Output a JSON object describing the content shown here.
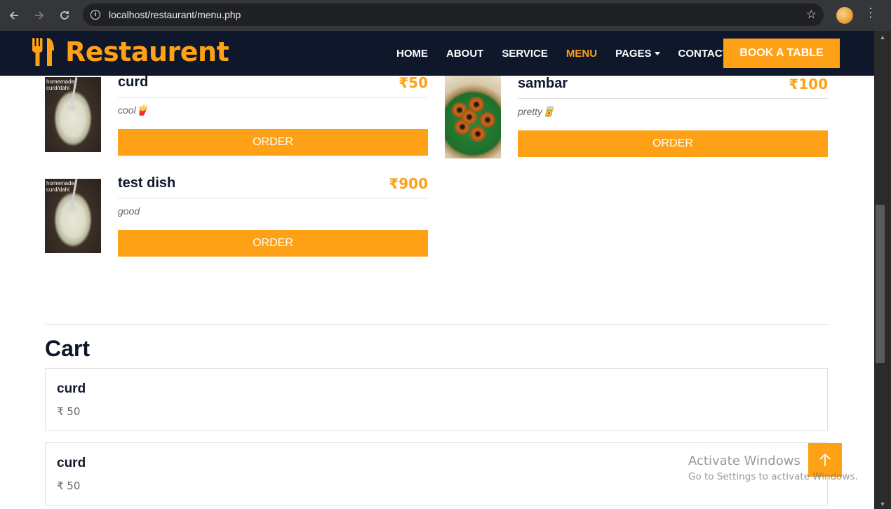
{
  "browser": {
    "url": "localhost/restaurant/menu.php",
    "back_icon": "arrow-left",
    "forward_icon": "arrow-right",
    "reload_icon": "reload",
    "info_icon": "info-circle",
    "bookmark_icon": "star-outline",
    "menu_icon": "vertical-dots"
  },
  "navbar": {
    "brand": "Restaurent",
    "links": [
      {
        "label": "HOME",
        "active": false
      },
      {
        "label": "ABOUT",
        "active": false
      },
      {
        "label": "SERVICE",
        "active": false
      },
      {
        "label": "MENU",
        "active": true
      },
      {
        "label": "PAGES",
        "active": false,
        "dropdown": true
      },
      {
        "label": "CONTACT",
        "active": false
      }
    ],
    "cta": "BOOK A TABLE"
  },
  "menu_items": [
    {
      "name": "curd",
      "price": "₹50",
      "desc": "cool🍟",
      "button": "ORDER",
      "image_label": "homemade\ncurd/dahi"
    },
    {
      "name": "sambar",
      "price": "₹100",
      "desc": "pretty🥫",
      "button": "ORDER"
    },
    {
      "name": "test dish",
      "price": "₹900",
      "desc": "good",
      "button": "ORDER",
      "image_label": "homemade\ncurd/dahi"
    }
  ],
  "cart": {
    "title": "Cart",
    "items": [
      {
        "name": "curd",
        "price": "₹ 50"
      },
      {
        "name": "curd",
        "price": "₹ 50"
      }
    ]
  },
  "back_to_top_icon": "arrow-up",
  "watermark": {
    "title": "Activate Windows",
    "subtitle": "Go to Settings to activate Windows."
  },
  "colors": {
    "primary": "#fea116",
    "dark": "#0f172b"
  }
}
